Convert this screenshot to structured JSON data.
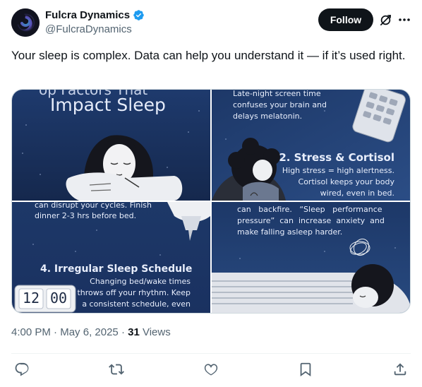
{
  "author": {
    "display_name": "Fulcra Dynamics",
    "handle": "@FulcraDynamics",
    "verified": true
  },
  "header": {
    "follow_label": "Follow",
    "grok_icon": "grok-icon",
    "more_icon": "more-icon"
  },
  "tweet": {
    "text": "Your sleep is complex. Data can help you understand it — if it’s used right."
  },
  "media": {
    "panel1": {
      "heading_partial": "op Factors That",
      "heading": "Impact Sleep"
    },
    "panel2": {
      "top_line1": "Late-night screen time",
      "top_line2": "confuses your brain and",
      "top_line3": "delays melatonin.",
      "title": "2. Stress & Cortisol",
      "body_line1": "High stress = high alertness.",
      "body_line2": "Cortisol keeps your body",
      "body_line3": "wired, even in bed."
    },
    "panel3": {
      "top_line1": "can disrupt your cycles. Finish",
      "top_line2": "dinner 2-3 hrs before bed.",
      "title": "4. Irregular Sleep Schedule",
      "body_line1": "Changing bed/wake times",
      "body_line2": "throws off your rhythm. Keep",
      "body_line3": "a consistent schedule, even",
      "clock_hours": "12",
      "clock_minutes": "00"
    },
    "panel4": {
      "line1": "can   backfire.   “Sleep   performance",
      "line2": "pressure”  can  increase  anxiety  and",
      "line3": "make falling asleep harder."
    }
  },
  "meta": {
    "time": "4:00 PM",
    "separator": "·",
    "date": "May 6, 2025",
    "views_count": "31",
    "views_label": "Views"
  },
  "actions": {
    "reply_icon": "reply-icon",
    "repost_icon": "repost-icon",
    "like_icon": "like-icon",
    "bookmark_icon": "bookmark-icon",
    "share_icon": "share-icon"
  },
  "colors": {
    "follow_bg": "#0f1419",
    "verified": "#1d9bf0",
    "secondary_text": "#536471",
    "panel_navy": "#1b3566"
  }
}
